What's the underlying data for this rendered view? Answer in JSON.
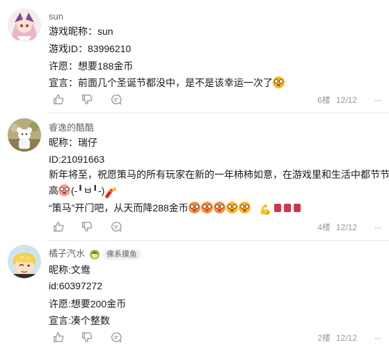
{
  "comments": [
    {
      "username": "sun",
      "lines": [
        "游戏昵称：sun",
        "游戏ID：83996210",
        "许愿：想要188金币",
        "宣言：前面几个圣诞节都没中，是不是该幸运一次了"
      ],
      "floor": "6楼",
      "date": "12/12"
    },
    {
      "username": "睿逸的酷酷",
      "lines": [
        "昵称：瑞仔",
        "ID:21091663",
        "新年将至，祝愿策马的所有玩家在新的一年柿柿如意，在游戏里和生活中都节节升",
        "高",
        "(-╹ㅂ╹-)",
        "“策马”开门吧，从天而降288金币"
      ],
      "floor": "4楼",
      "date": "12/12"
    },
    {
      "username": "橘子汽水",
      "fan_tag": "佛系摸鱼",
      "lines": [
        "昵称:文鸯",
        "id:60397272",
        "许愿:想要200金币",
        "宣言:凑个整数"
      ],
      "floor": "2楼",
      "date": "12/12"
    }
  ],
  "more_label": "···",
  "icons": [
    "thumb-up-icon",
    "thumb-down-icon",
    "reply-icon"
  ],
  "colors": {
    "text": "#18191c",
    "secondary": "#61666d",
    "meta": "#9499a0",
    "divider": "#e3e5e7"
  }
}
